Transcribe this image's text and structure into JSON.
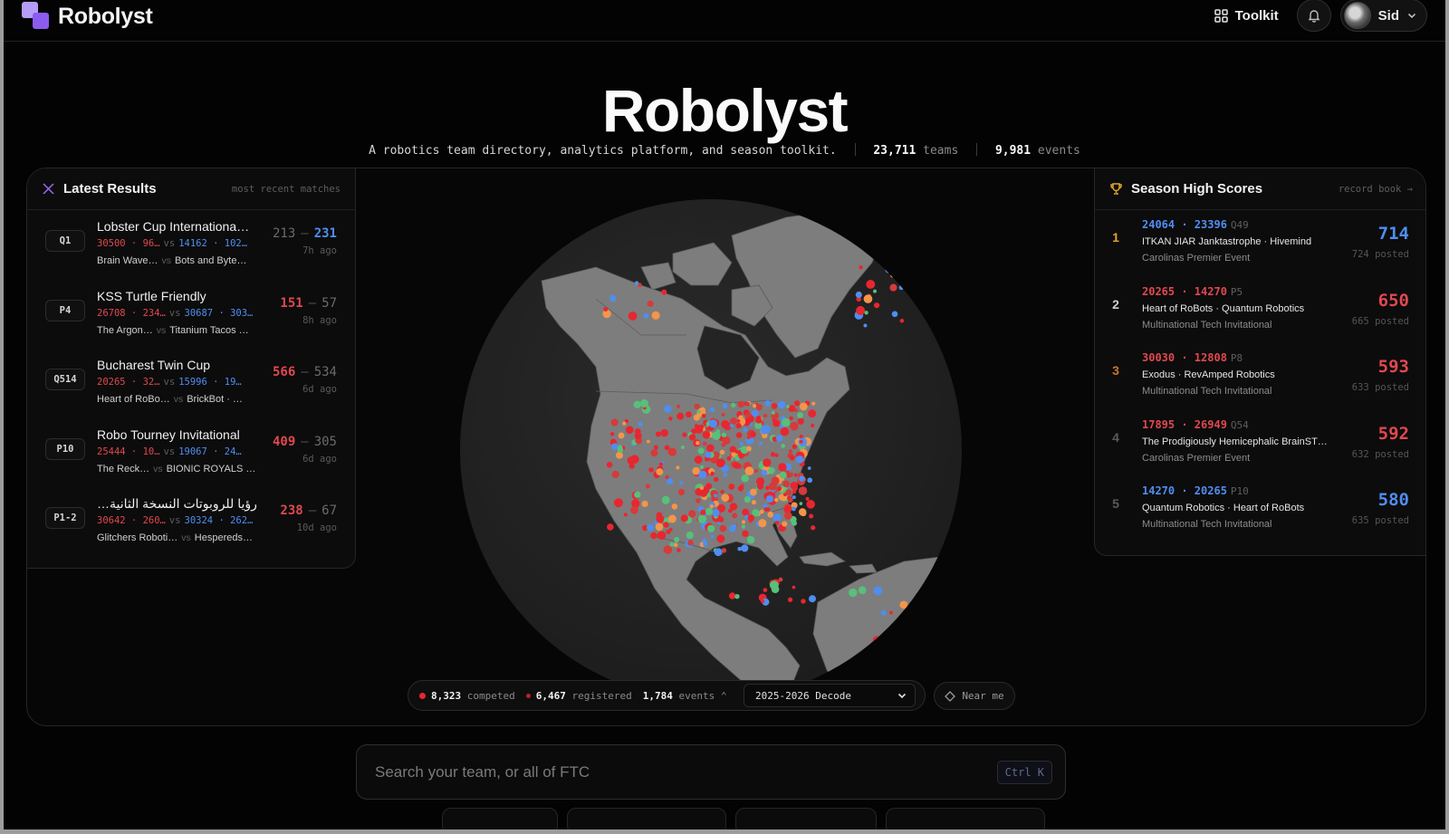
{
  "nav": {
    "logo_text": "Robolyst",
    "toolkit_label": "Toolkit",
    "user_name": "Sid"
  },
  "hero": {
    "title": "Robolyst",
    "tagline": "A robotics team directory, analytics platform, and season toolkit.",
    "teams_count": "23,711",
    "teams_label": "teams",
    "events_count": "9,981",
    "events_label": "events"
  },
  "latest_results": {
    "title": "Latest Results",
    "subtitle": "most recent matches",
    "matches": [
      {
        "code": "Q1",
        "event": "Lobster Cup Internationa…",
        "red_teams": "30500 · 96…",
        "blue_teams": "14162 · 102…",
        "red_names": "Brain Wave…",
        "blue_names": "Bots and Byte…",
        "red_score": "213",
        "blue_score": "231",
        "winner": "blue",
        "time": "7h ago"
      },
      {
        "code": "P4",
        "event": "KSS Turtle Friendly",
        "red_teams": "26708 · 234…",
        "blue_teams": "30687 · 303…",
        "red_names": "The Argon…",
        "blue_names": "Titanium Tacos …",
        "red_score": "151",
        "blue_score": "57",
        "winner": "red",
        "time": "8h ago"
      },
      {
        "code": "Q514",
        "event": "Bucharest Twin Cup",
        "red_teams": "20265 · 32…",
        "blue_teams": "15996 · 19…",
        "red_names": "Heart of RoBo…",
        "blue_names": "BrickBot · …",
        "red_score": "566",
        "blue_score": "534",
        "winner": "red",
        "time": "6d ago"
      },
      {
        "code": "P10",
        "event": "Robo Tourney Invitational",
        "red_teams": "25444 · 10…",
        "blue_teams": "19067 · 24…",
        "red_names": "The Reck…",
        "blue_names": "BIONIC ROYALS …",
        "red_score": "409",
        "blue_score": "305",
        "winner": "red",
        "time": "6d ago"
      },
      {
        "code": "P1-2",
        "event": "…رؤيا للروبوتات النسخة الثانية",
        "red_teams": "30642 · 260…",
        "blue_teams": "30324 · 262…",
        "red_names": "Glitchers Roboti…",
        "blue_names": "Hespereds…",
        "red_score": "238",
        "blue_score": "67",
        "winner": "red",
        "time": "10d ago"
      }
    ],
    "vs_label": "vs"
  },
  "high_scores": {
    "title": "Season High Scores",
    "subtitle": "record book →",
    "entries": [
      {
        "rank": "1",
        "teams": "24064 · 23396",
        "match": "Q49",
        "names": "ITKAN JIAR Janktastrophe · Hivemind",
        "event": "Carolinas Premier Event",
        "score": "714",
        "posted": "724 posted",
        "alliance": "blue",
        "rank_color": "#e2a52a"
      },
      {
        "rank": "2",
        "teams": "20265 · 14270",
        "match": "P5",
        "names": "Heart of RoBots · Quantum Robotics",
        "event": "Multinational Tech Invitational",
        "score": "650",
        "posted": "665 posted",
        "alliance": "red",
        "rank_color": "#d0d0d0"
      },
      {
        "rank": "3",
        "teams": "30030 · 12808",
        "match": "P8",
        "names": "Exodus · RevAmped Robotics",
        "event": "Multinational Tech Invitational",
        "score": "593",
        "posted": "633 posted",
        "alliance": "red",
        "rank_color": "#c9762a"
      },
      {
        "rank": "4",
        "teams": "17895 · 26949",
        "match": "Q54",
        "names": "The Prodigiously Hemicephalic BrainST…",
        "event": "Carolinas Premier Event",
        "score": "592",
        "posted": "632 posted",
        "alliance": "red",
        "rank_color": "#5a5a5a"
      },
      {
        "rank": "5",
        "teams": "14270 · 20265",
        "match": "P10",
        "names": "Quantum Robotics · Heart of RoBots",
        "event": "Multinational Tech Invitational",
        "score": "580",
        "posted": "635 posted",
        "alliance": "blue",
        "rank_color": "#5a5a5a"
      }
    ]
  },
  "map_stats": {
    "competed_count": "8,323",
    "competed_label": "competed",
    "registered_count": "6,467",
    "registered_label": "registered",
    "events_count": "1,784",
    "events_label": "events",
    "season": "2025-2026 Decode",
    "near_me_label": "Near me"
  },
  "search": {
    "placeholder": "Search your team, or all of FTC",
    "shortcut": "Ctrl K"
  },
  "colors": {
    "red_alliance": "#e0484f",
    "blue_alliance": "#4f8ef0",
    "competed_dot": "#e8262f",
    "orange_dot": "#f3954a",
    "brand": "#8a5cf0"
  }
}
